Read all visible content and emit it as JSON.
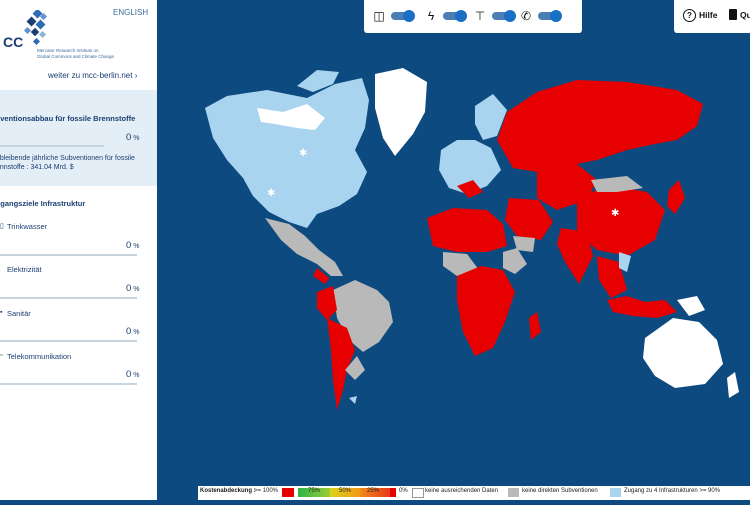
{
  "header": {
    "language_link": "ENGLISH",
    "logo_text": "CC",
    "logo_description": [
      "Mercator Research Institute on",
      "Global Commons and Climate Change"
    ],
    "mcc_link": "weiter zu mcc-berlin.net ›"
  },
  "subsidy_section": {
    "title": "...ventionsabbau für fossile Brennstoffe",
    "percent": "0",
    "unit": "%",
    "description": "...bleibende jährliche Subventionen für fossile ...nnstoffe : 341.04 Mrd. $"
  },
  "infrastructure_section": {
    "title": "...gangsziele Infrastruktur",
    "items": [
      {
        "label": "Trinkwasser",
        "percent": "0",
        "unit": "%"
      },
      {
        "label": "Elektrizität",
        "percent": "0",
        "unit": "%"
      },
      {
        "label": "Sanitär",
        "percent": "0",
        "unit": "%"
      },
      {
        "label": "Telekommunikation",
        "percent": "0",
        "unit": "%"
      }
    ]
  },
  "toggles": [
    {
      "icon": "water-glass-icon",
      "glyph": "▿",
      "on": true
    },
    {
      "icon": "lightning-icon",
      "glyph": "⚡",
      "on": true
    },
    {
      "icon": "faucet-icon",
      "glyph": "⊤",
      "on": true
    },
    {
      "icon": "phone-icon",
      "glyph": "✆",
      "on": true
    }
  ],
  "help": {
    "help_label": "Hilfe",
    "second_label": "Qu"
  },
  "legend": {
    "prefix": "Kostenabdeckung :",
    "full": ">= 100%",
    "p75": "75%",
    "p50": "50%",
    "p25": "25%",
    "p0": "0%",
    "no_data": "keine ausreichenden Daten",
    "no_subsidies": "keine direkten Subventionen",
    "access": "Zugang zu 4 Infrastrukturen >= 90%"
  },
  "colors": {
    "ocean": "#0c4a80",
    "full_coverage": "#e60000",
    "no_data": "#ffffff",
    "no_subsidies": "#b9b9b9",
    "access": "#a9d4ef",
    "brand": "#1b3f73"
  }
}
